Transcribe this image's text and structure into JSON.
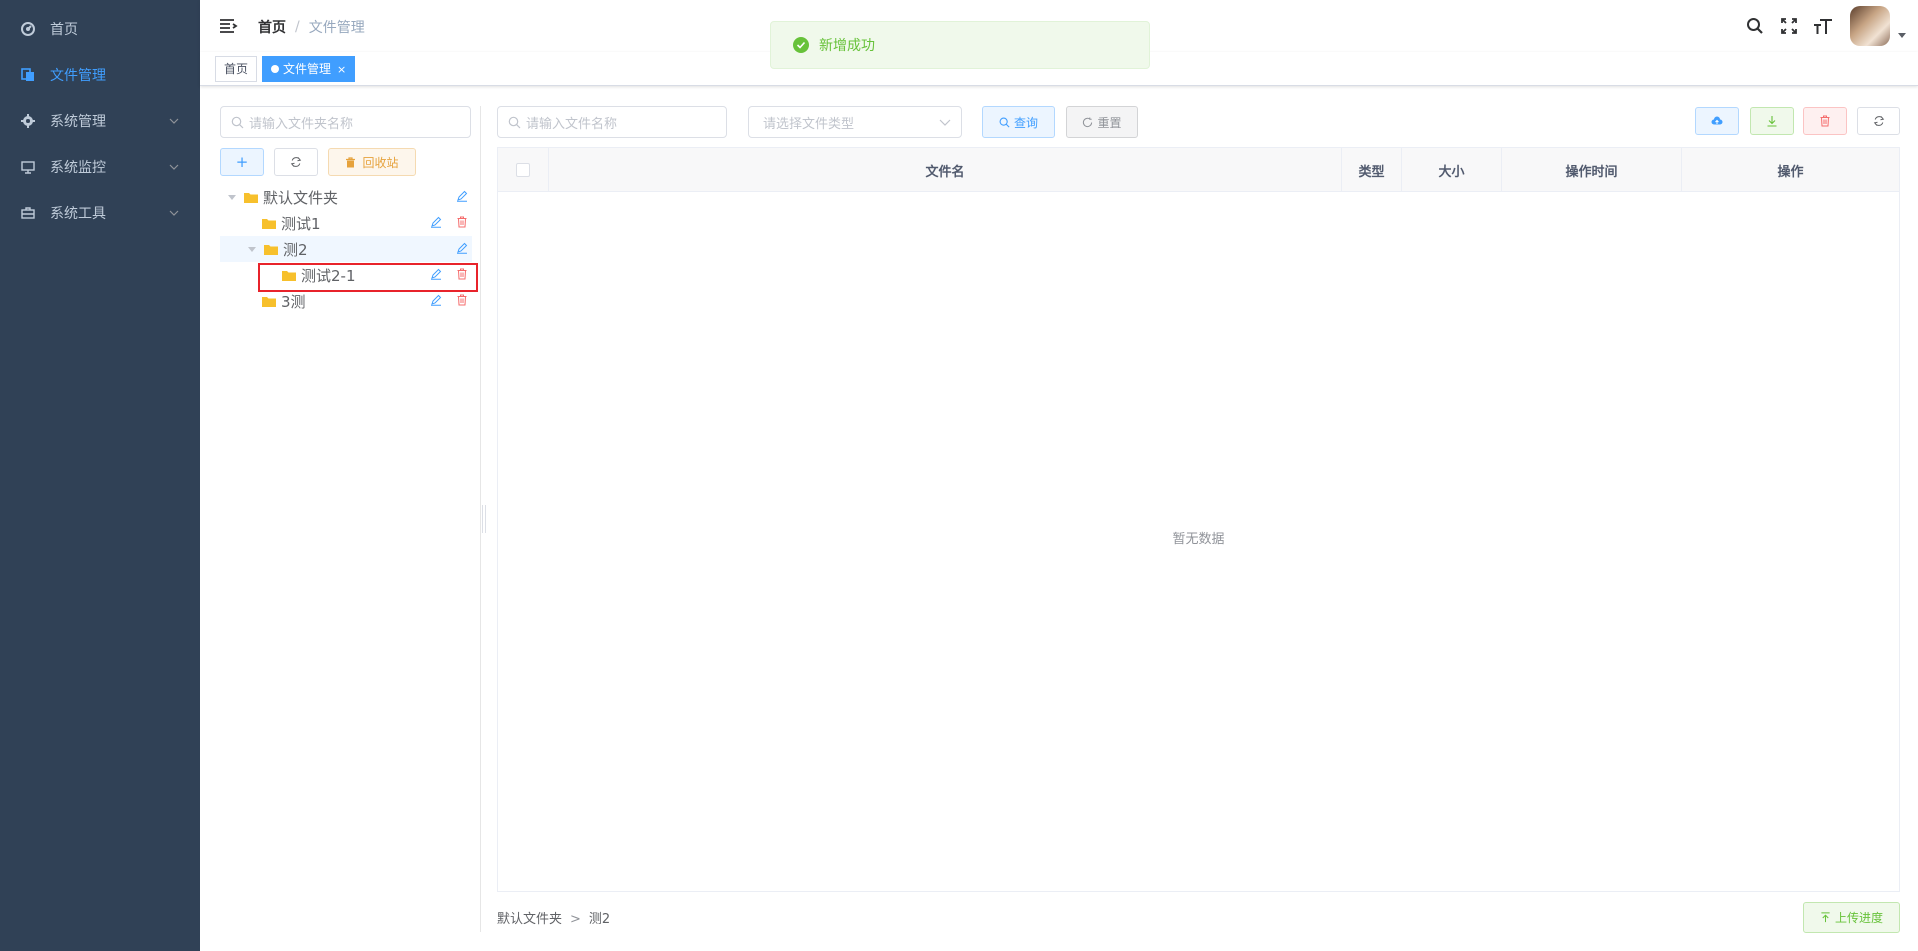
{
  "sidebar": {
    "items": [
      {
        "label": "首页",
        "icon": "dashboard-icon",
        "active": false,
        "has_arrow": false
      },
      {
        "label": "文件管理",
        "icon": "file-icon",
        "active": true,
        "has_arrow": false
      },
      {
        "label": "系统管理",
        "icon": "gear-icon",
        "active": false,
        "has_arrow": true
      },
      {
        "label": "系统监控",
        "icon": "monitor-icon",
        "active": false,
        "has_arrow": true
      },
      {
        "label": "系统工具",
        "icon": "toolbox-icon",
        "active": false,
        "has_arrow": true
      }
    ]
  },
  "navbar": {
    "breadcrumb": {
      "home": "首页",
      "separator": "/",
      "current": "文件管理"
    }
  },
  "tags": [
    {
      "label": "首页",
      "active": false
    },
    {
      "label": "文件管理",
      "active": true,
      "close": "×"
    }
  ],
  "toast": {
    "message": "新增成功",
    "color": "#67c23a"
  },
  "tree_panel": {
    "search_placeholder": "请输入文件夹名称",
    "add_label": "+",
    "recycle_label": "回收站",
    "nodes": [
      {
        "label": "默认文件夹",
        "level": 0,
        "expanded": true,
        "edit": true,
        "delete": false
      },
      {
        "label": "测试1",
        "level": 1,
        "expanded": false,
        "edit": true,
        "delete": true
      },
      {
        "label": "测2",
        "level": 1,
        "expanded": true,
        "edit": true,
        "delete": false,
        "current": true
      },
      {
        "label": "测试2-1",
        "level": 2,
        "expanded": false,
        "edit": true,
        "delete": true,
        "highlighted": true
      },
      {
        "label": "3测",
        "level": 1,
        "expanded": false,
        "edit": true,
        "delete": true
      }
    ]
  },
  "file_toolbar": {
    "name_placeholder": "请输入文件名称",
    "type_placeholder": "请选择文件类型",
    "query_label": "查询",
    "reset_label": "重置"
  },
  "table": {
    "columns": [
      "文件名",
      "类型",
      "大小",
      "操作时间",
      "操作"
    ],
    "empty_text": "暂无数据"
  },
  "footer": {
    "path": [
      "默认文件夹",
      "测2"
    ],
    "path_separator": ">",
    "upload_progress_label": "上传进度"
  },
  "colors": {
    "primary": "#409eff",
    "sidebar_bg": "#304156",
    "success": "#67c23a",
    "danger": "#f56c6c",
    "warning": "#e6a23c"
  }
}
